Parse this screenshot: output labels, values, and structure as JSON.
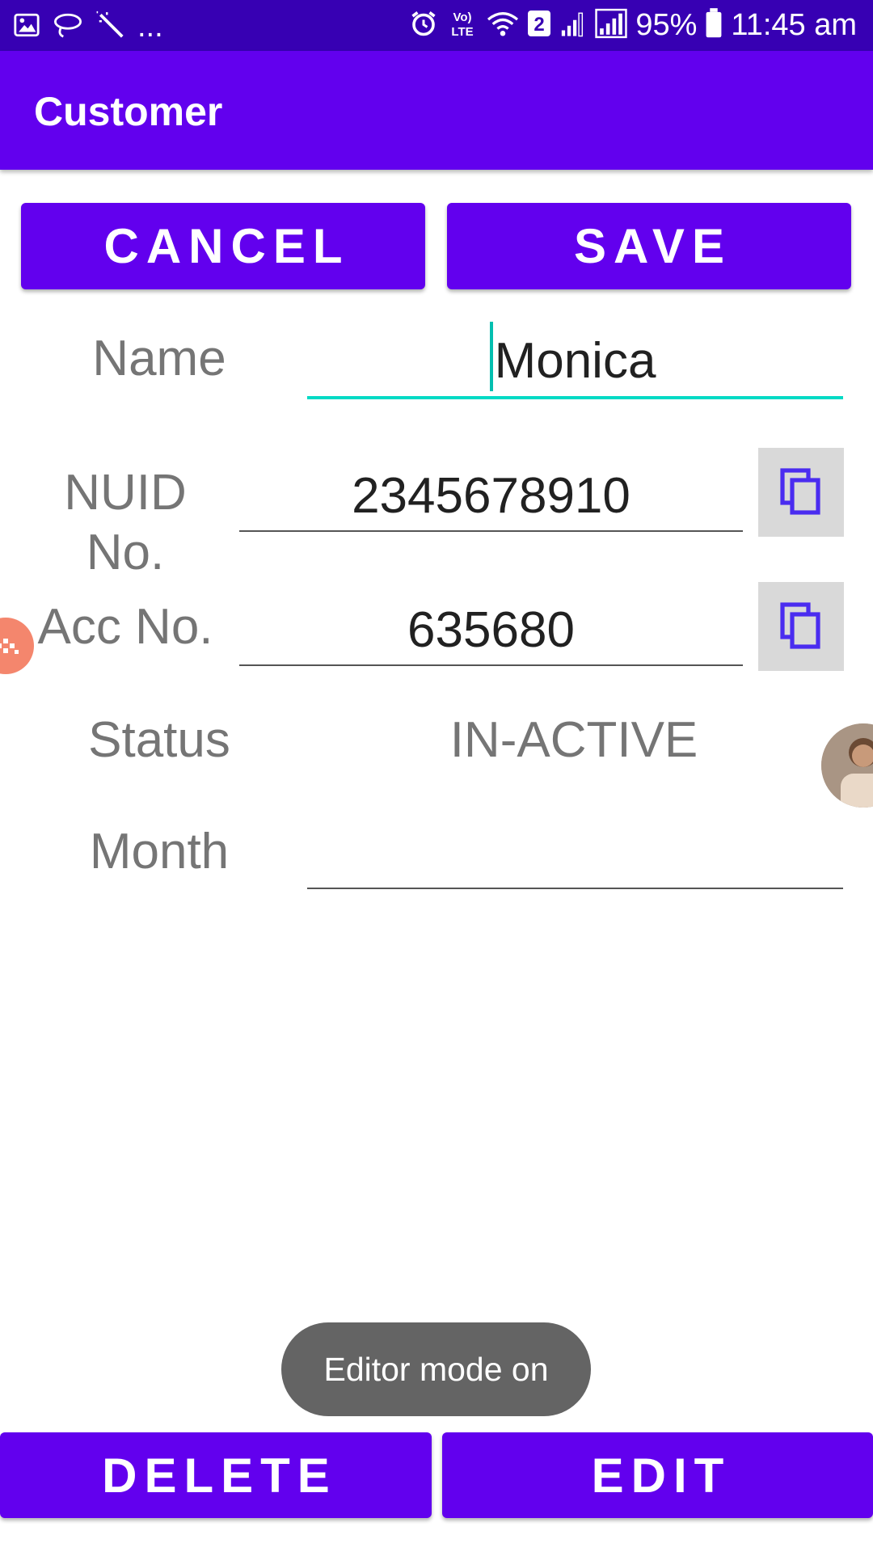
{
  "status_bar": {
    "left_icons": [
      "image-icon",
      "lasso-icon",
      "magic-wand-icon"
    ],
    "more": "...",
    "right_icons": [
      "alarm-icon",
      "volte-icon",
      "wifi-icon",
      "sim2-badge-icon",
      "signal-icon",
      "signal-icon",
      "battery-icon"
    ],
    "volte_text": "Vo) LTE",
    "sim_badge": "2",
    "battery": "95%",
    "time": "11:45 am"
  },
  "app_bar": {
    "title": "Customer"
  },
  "actions": {
    "cancel_label": "CANCEL",
    "save_label": "SAVE"
  },
  "form": {
    "name": {
      "label": "Name",
      "value": "Monica"
    },
    "nuid": {
      "label": "NUID No.",
      "value": "2345678910"
    },
    "acc": {
      "label": "Acc No.",
      "value": "635680"
    },
    "status": {
      "label": "Status",
      "value": "IN-ACTIVE"
    },
    "month": {
      "label": "Month",
      "value": ""
    }
  },
  "toast": {
    "text": "Editor mode on"
  },
  "bottom_actions": {
    "delete_label": "DELETE",
    "edit_label": "EDIT"
  },
  "colors": {
    "primary": "#6200ee",
    "primary_dark": "#3700b3",
    "accent": "#03dac5",
    "icon_tint": "#4a2cf0"
  }
}
